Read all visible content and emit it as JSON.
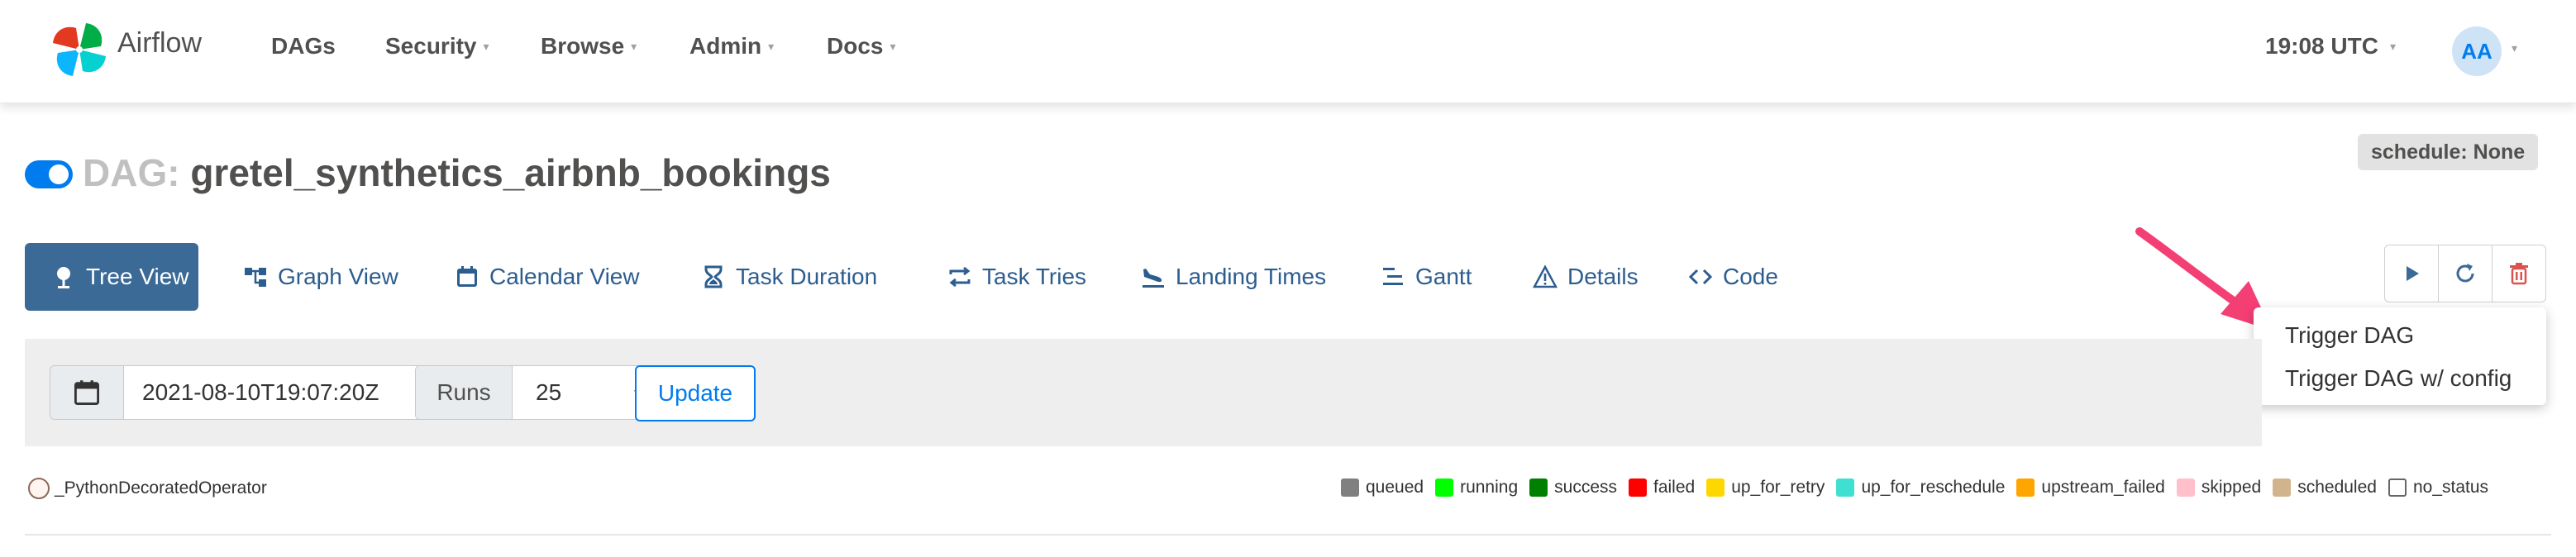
{
  "navbar": {
    "brand": "Airflow",
    "items": [
      {
        "label": "DAGs",
        "dropdown": false
      },
      {
        "label": "Security",
        "dropdown": true
      },
      {
        "label": "Browse",
        "dropdown": true
      },
      {
        "label": "Admin",
        "dropdown": true
      },
      {
        "label": "Docs",
        "dropdown": true
      }
    ],
    "clock": "19:08 UTC",
    "user_initials": "AA"
  },
  "dag": {
    "prefix": "DAG:",
    "name": "gretel_synthetics_airbnb_bookings",
    "schedule": "schedule: None",
    "enabled": true
  },
  "tabs": [
    {
      "label": "Tree View",
      "icon": "tree-icon",
      "active": true
    },
    {
      "label": "Graph View",
      "icon": "graph-icon",
      "active": false
    },
    {
      "label": "Calendar View",
      "icon": "calendar-icon",
      "active": false
    },
    {
      "label": "Task Duration",
      "icon": "hourglass-icon",
      "active": false
    },
    {
      "label": "Task Tries",
      "icon": "retry-icon",
      "active": false
    },
    {
      "label": "Landing Times",
      "icon": "plane-landing-icon",
      "active": false
    },
    {
      "label": "Gantt",
      "icon": "gantt-icon",
      "active": false
    },
    {
      "label": "Details",
      "icon": "warning-triangle-icon",
      "active": false
    },
    {
      "label": "Code",
      "icon": "code-icon",
      "active": false
    }
  ],
  "actions": {
    "icons": [
      "play-icon",
      "refresh-icon",
      "trash-icon"
    ],
    "colors": {
      "trash": "#d9534f",
      "play": "#3b6a96"
    }
  },
  "dropdown": {
    "items": [
      "Trigger DAG",
      "Trigger DAG w/ config"
    ]
  },
  "filter": {
    "date_value": "2021-08-10T19:07:20Z",
    "runs_label": "Runs",
    "runs_value": "25",
    "update_label": "Update"
  },
  "operator_legend": {
    "label": "_PythonDecoratedOperator"
  },
  "state_legend": [
    {
      "label": "queued",
      "color": "#808080",
      "outlined": false
    },
    {
      "label": "running",
      "color": "#00ff00",
      "outlined": false
    },
    {
      "label": "success",
      "color": "#008000",
      "outlined": false
    },
    {
      "label": "failed",
      "color": "#ff0000",
      "outlined": false
    },
    {
      "label": "up_for_retry",
      "color": "#ffd700",
      "outlined": false
    },
    {
      "label": "up_for_reschedule",
      "color": "#40e0d0",
      "outlined": false
    },
    {
      "label": "upstream_failed",
      "color": "#ffa500",
      "outlined": false
    },
    {
      "label": "skipped",
      "color": "#ffc0cb",
      "outlined": false
    },
    {
      "label": "scheduled",
      "color": "#d2b48c",
      "outlined": false
    },
    {
      "label": "no_status",
      "color": "#ffffff",
      "outlined": true
    }
  ],
  "colors": {
    "accent": "#017cee",
    "tab_active_bg": "#3b6a96",
    "tab_text": "#2c5d8f",
    "annotation_arrow": "#f43f74"
  }
}
